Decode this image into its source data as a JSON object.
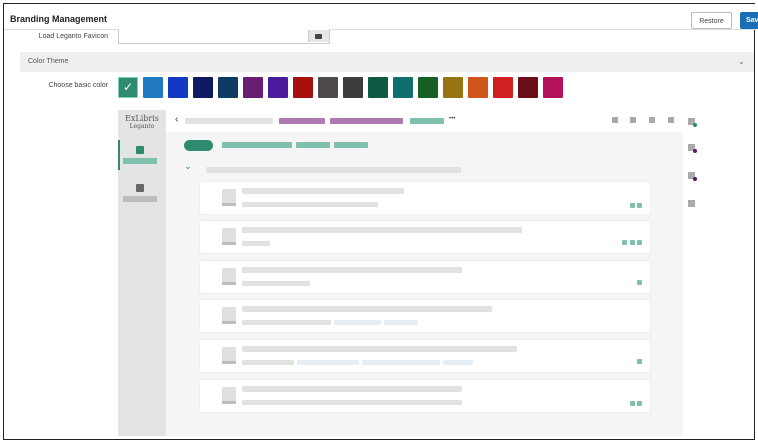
{
  "header": {
    "title": "Branding Management",
    "restore_label": "Restore",
    "save_label": "Save"
  },
  "favicon": {
    "label": "Load Leganto Favicon",
    "upload_icon": "folder-icon"
  },
  "color_theme": {
    "section_title": "Color Theme",
    "collapse_icon": "chevron-down-icon",
    "choose_label": "Choose basic color",
    "selected_index": 0,
    "swatches": [
      "#2e8b6f",
      "#1f7ac0",
      "#1438c6",
      "#0f1a63",
      "#0f3a63",
      "#6a1e72",
      "#4a1c9c",
      "#a80f0f",
      "#4f4a4a",
      "#3d3d3d",
      "#0e5a45",
      "#0f6e6e",
      "#155f24",
      "#967413",
      "#cf551a",
      "#d02020",
      "#6a0f1a",
      "#b5105a"
    ]
  },
  "preview": {
    "logo_line1": "ExLibris",
    "logo_line2": "Leganto",
    "back_glyph": "‹",
    "more_glyph": "•••",
    "expand_glyph": "⌄",
    "accent_color": "#2e8b6f",
    "secondary_color": "#b07ab0",
    "right_icon_dot_colors": [
      "#2e8b6f",
      "#5a1a6a",
      "#5a1a6a"
    ]
  }
}
